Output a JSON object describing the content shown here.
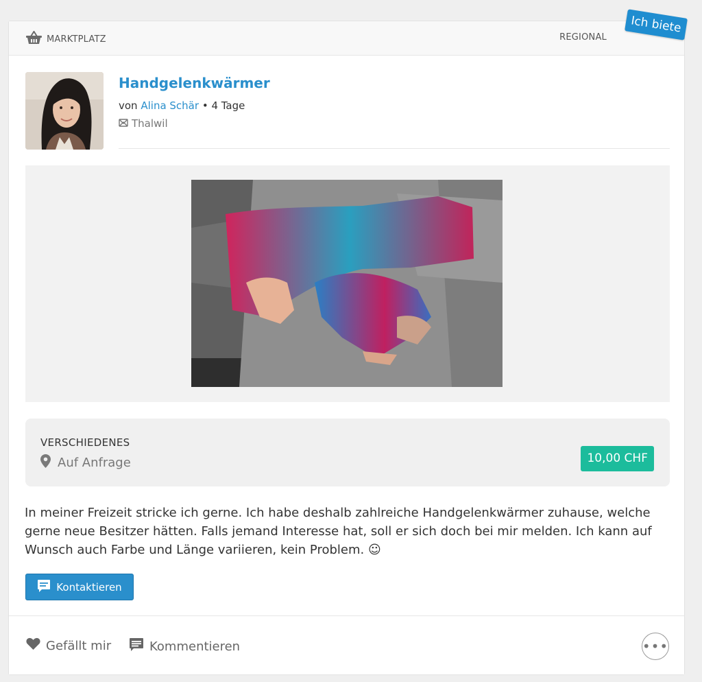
{
  "header": {
    "category_label": "MARKTPLATZ",
    "region_label": "REGIONAL",
    "ribbon_label": "Ich biete"
  },
  "post": {
    "title": "Handgelenkwärmer",
    "by_prefix": "von",
    "author": "Alina Schär",
    "age_suffix": "• 4 Tage",
    "location": "Thalwil"
  },
  "info": {
    "category": "VERSCHIEDENES",
    "availability": "Auf Anfrage",
    "price": "10,00 CHF"
  },
  "description": "In meiner Freizeit stricke ich gerne. Ich habe deshalb zahlreiche Handgelenkwärmer zuhause, welche gerne neue Besitzer hätten. Falls jemand Interesse hat, soll er sich doch bei mir melden. Ich kann auf Wunsch auch Farbe und Länge variieren, kein Problem. ☺",
  "actions": {
    "contact_label": "Kontaktieren",
    "like_label": "Gefällt mir",
    "comment_label": "Kommentieren",
    "more_label": "•••"
  },
  "colors": {
    "accent": "#2a8fcc",
    "ribbon": "#1f8dd0",
    "price_badge": "#1cbc9c"
  },
  "icons": {
    "header": "basket-icon",
    "location": "location-icon",
    "pin": "map-pin-icon",
    "contact": "chat-bubble-icon",
    "like": "heart-icon",
    "comment": "comment-icon",
    "more": "more-icon"
  }
}
